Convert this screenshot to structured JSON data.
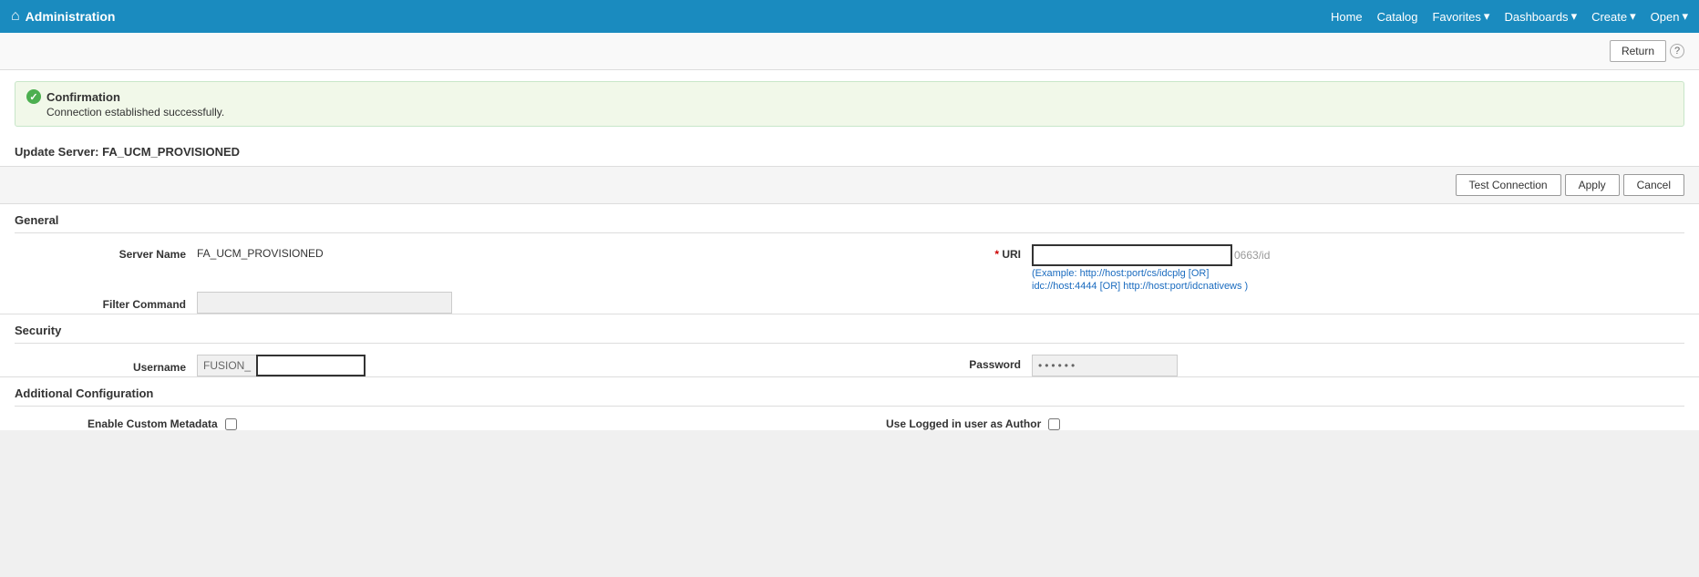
{
  "nav": {
    "title": "Administration",
    "home_icon": "⌂",
    "links": [
      {
        "label": "Home"
      },
      {
        "label": "Catalog"
      },
      {
        "label": "Favorites",
        "dropdown": true
      },
      {
        "label": "Dashboards",
        "dropdown": true
      },
      {
        "label": "Create",
        "dropdown": true
      },
      {
        "label": "Open",
        "dropdown": true
      }
    ]
  },
  "header": {
    "return_label": "Return",
    "help_label": "?"
  },
  "confirmation": {
    "title": "Confirmation",
    "check": "✓",
    "message": "Connection established successfully."
  },
  "page": {
    "update_server_title": "Update Server: FA_UCM_PROVISIONED"
  },
  "action_bar": {
    "test_connection_label": "Test Connection",
    "apply_label": "Apply",
    "cancel_label": "Cancel"
  },
  "general": {
    "section_title": "General",
    "server_name_label": "Server Name",
    "server_name_value": "FA_UCM_PROVISIONED",
    "uri_label": "* URI",
    "uri_value": "",
    "uri_suffix": "0663/id",
    "uri_example_line1": "(Example: http://host:port/cs/idcplg [OR]",
    "uri_example_line2": "idc://host:4444 [OR] http://host:port/idcnativews )",
    "filter_command_label": "Filter Command",
    "filter_command_value": ""
  },
  "security": {
    "section_title": "Security",
    "username_label": "Username",
    "username_prefix": "FUSION_",
    "username_value": "",
    "password_label": "Password",
    "password_value": "••••••"
  },
  "additional": {
    "section_title": "Additional Configuration",
    "enable_custom_metadata_label": "Enable Custom Metadata",
    "use_logged_in_user_label": "Use Logged in user as Author"
  }
}
